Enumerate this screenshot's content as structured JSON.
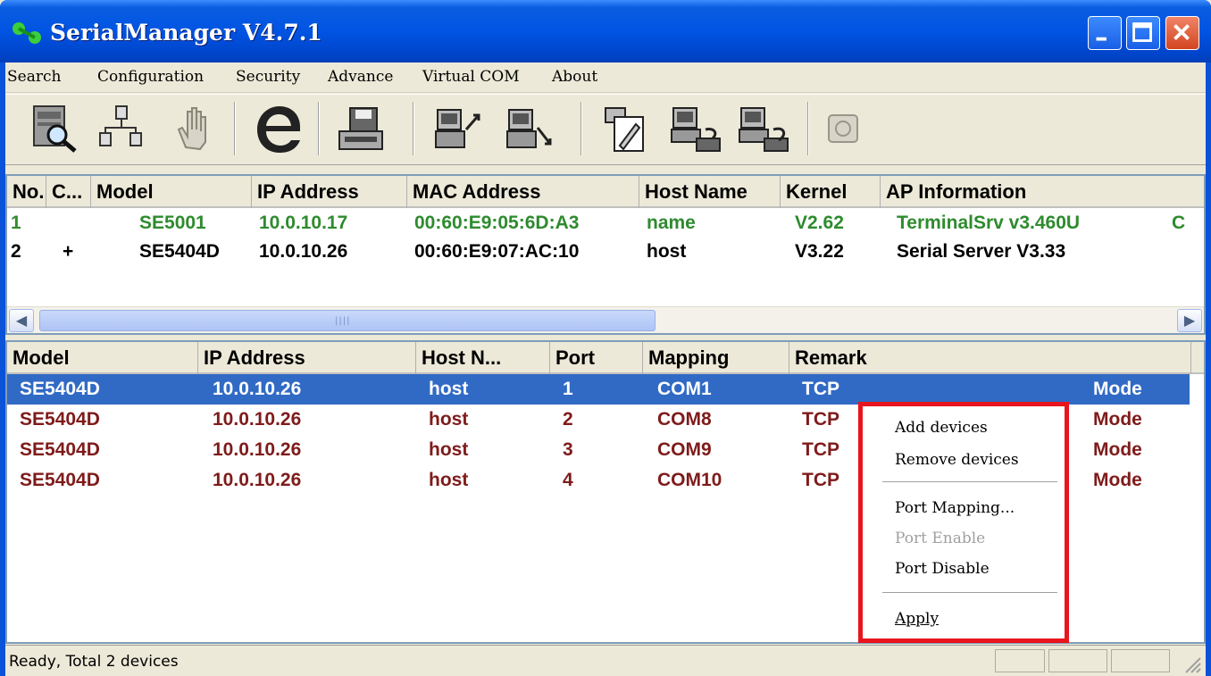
{
  "window": {
    "title": "SerialManager V4.7.1"
  },
  "menu": [
    {
      "label": "Search"
    },
    {
      "label": "Configuration"
    },
    {
      "label": "Security"
    },
    {
      "label": "Advance"
    },
    {
      "label": "Virtual COM"
    },
    {
      "label": "About"
    }
  ],
  "toolbar_icons": [
    "search-device-icon",
    "network-config-icon",
    "security-hand-icon",
    "internet-explorer-icon",
    "save-config-icon",
    "upload-config-icon",
    "download-config-icon",
    "edit-config-icon",
    "virtual-com-add-icon",
    "virtual-com-remove-icon",
    "dialup-phone-icon"
  ],
  "device_table": {
    "headers": [
      "No.",
      "C...",
      "Model",
      "IP Address",
      "MAC Address",
      "Host Name",
      "Kernel",
      "AP Information"
    ],
    "rows": [
      {
        "no": "1",
        "c": "",
        "model": "SE5001",
        "ip": "10.0.10.17",
        "mac": "00:60:E9:05:6D:A3",
        "host": "name",
        "kernel": "V2.62",
        "ap": "TerminalSrv v3.460U",
        "extra": "C"
      },
      {
        "no": "2",
        "c": "+",
        "model": "SE5404D",
        "ip": "10.0.10.26",
        "mac": "00:60:E9:07:AC:10",
        "host": "host",
        "kernel": "V3.22",
        "ap": "Serial Server V3.33",
        "extra": ""
      }
    ]
  },
  "port_table": {
    "headers": [
      "Model",
      "IP Address",
      "Host N...",
      "Port",
      "Mapping",
      "Remark"
    ],
    "rows": [
      {
        "model": "SE5404D",
        "ip": "10.0.10.26",
        "host": "host",
        "port": "1",
        "mapping": "COM1",
        "remark_a": "TCP",
        "remark_b": "Mode",
        "selected": true
      },
      {
        "model": "SE5404D",
        "ip": "10.0.10.26",
        "host": "host",
        "port": "2",
        "mapping": "COM8",
        "remark_a": "TCP",
        "remark_b": "Mode",
        "selected": false
      },
      {
        "model": "SE5404D",
        "ip": "10.0.10.26",
        "host": "host",
        "port": "3",
        "mapping": "COM9",
        "remark_a": "TCP",
        "remark_b": "Mode",
        "selected": false
      },
      {
        "model": "SE5404D",
        "ip": "10.0.10.26",
        "host": "host",
        "port": "4",
        "mapping": "COM10",
        "remark_a": "TCP",
        "remark_b": "Mode",
        "selected": false
      }
    ]
  },
  "context_menu": {
    "items": [
      {
        "label": "Add devices",
        "enabled": true
      },
      {
        "label": "Remove devices",
        "enabled": true
      },
      {
        "label": "Port Mapping...",
        "enabled": true
      },
      {
        "label": "Port Enable",
        "enabled": false
      },
      {
        "label": "Port Disable",
        "enabled": true
      },
      {
        "label": "Apply",
        "enabled": true
      }
    ]
  },
  "status": {
    "text": "Ready, Total 2 devices"
  },
  "colors": {
    "online": "#2e8b2e",
    "offline_port": "#7f1b1b",
    "selection": "#316ac5",
    "highlight_border": "#e8141e"
  }
}
